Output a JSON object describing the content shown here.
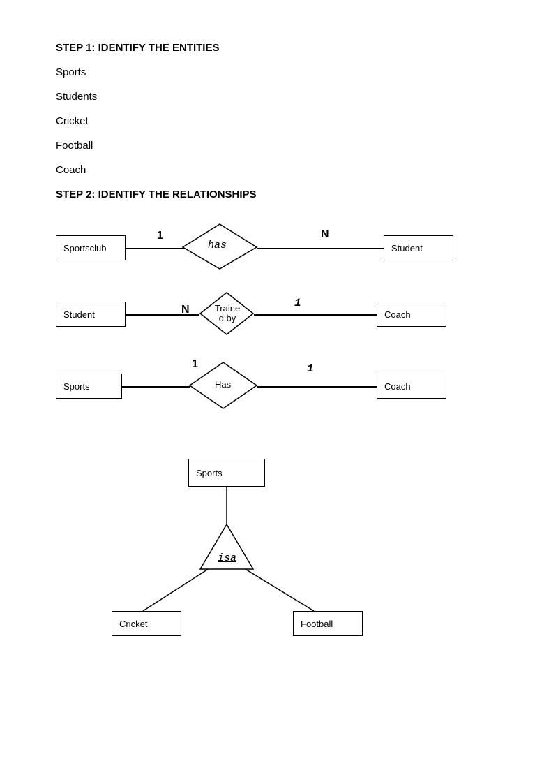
{
  "step1": {
    "title": "STEP 1: IDENTIFY THE ENTITIES",
    "entities": [
      "Sports",
      "Students",
      "Cricket",
      "Football",
      "Coach"
    ]
  },
  "step2": {
    "title": "STEP 2: IDENTIFY THE RELATIONSHIPS"
  },
  "rel1": {
    "left": "Sportsclub",
    "relationship": "has",
    "right": "Student",
    "leftCard": "1",
    "rightCard": "N"
  },
  "rel2": {
    "left": "Student",
    "relationship": "Traine d by",
    "right": "Coach",
    "leftCard": "N",
    "rightCard": "1"
  },
  "rel3": {
    "left": "Sports",
    "relationship": "Has",
    "right": "Coach",
    "leftCard": "1",
    "rightCard": "1"
  },
  "isa": {
    "parent": "Sports",
    "label": "isa",
    "children": [
      "Cricket",
      "Football"
    ]
  }
}
